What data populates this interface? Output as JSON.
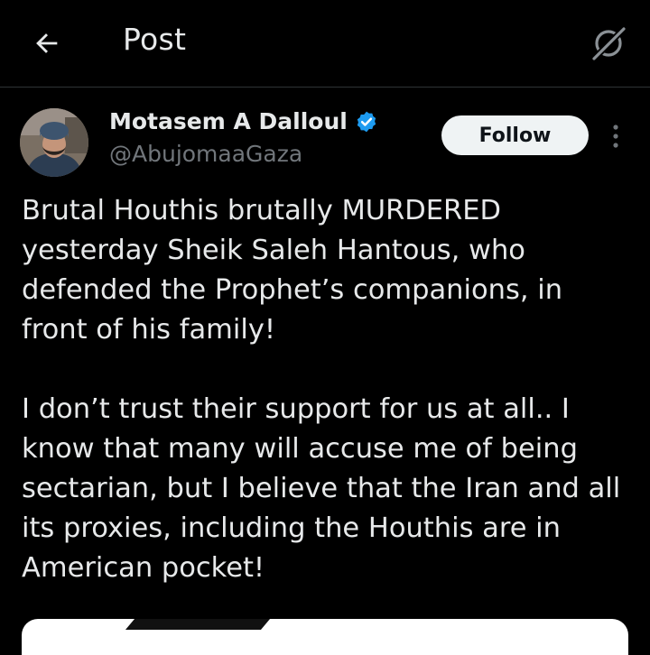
{
  "header": {
    "title": "Post",
    "back_icon": "arrow-left-icon",
    "grok_icon": "grok-icon"
  },
  "author": {
    "display_name": "Motasem A Dalloul",
    "handle": "@AbujomaaGaza",
    "verified": true,
    "verified_color": "#1d9bf0"
  },
  "actions": {
    "follow_label": "Follow",
    "more_icon": "more-vertical-icon"
  },
  "tweet": {
    "paragraphs": [
      "Brutal Houthis brutally MURDERED yesterday Sheik Saleh Hantous, who defended the Prophet’s companions, in front of his family!",
      "I don’t trust their support for us at all.. I know that many will accuse me of being sectarian, but I believe that the Iran and all its proxies, including the Houthis are in American pocket!"
    ]
  },
  "colors": {
    "background": "#000000",
    "text_primary": "#e7e9ea",
    "text_secondary": "#71767b",
    "divider": "#2f3336",
    "button_bg": "#eff3f4"
  }
}
